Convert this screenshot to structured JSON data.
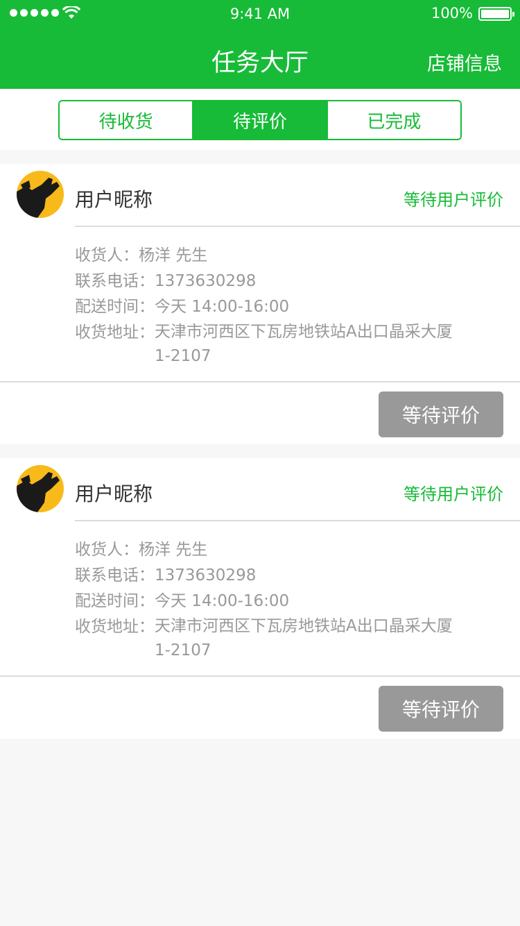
{
  "status_bar": {
    "time": "9:41 AM",
    "battery": "100%"
  },
  "header": {
    "title": "任务大厅",
    "right_action": "店铺信息"
  },
  "tabs": [
    {
      "label": "待收货",
      "active": false
    },
    {
      "label": "待评价",
      "active": true
    },
    {
      "label": "已完成",
      "active": false
    }
  ],
  "orders": [
    {
      "user_name": "用户昵称",
      "status": "等待用户评价",
      "receiver_label": "收货人：",
      "receiver": "杨洋 先生",
      "phone_label": "联系电话：",
      "phone": "1373630298",
      "time_label": "配送时间：",
      "time": "今天 14:00-16:00",
      "address_label": "收货地址：",
      "address": "天津市河西区下瓦房地铁站A出口晶采大厦1-2107",
      "button": "等待评价"
    },
    {
      "user_name": "用户昵称",
      "status": "等待用户评价",
      "receiver_label": "收货人：",
      "receiver": "杨洋 先生",
      "phone_label": "联系电话：",
      "phone": "1373630298",
      "time_label": "配送时间：",
      "time": "今天 14:00-16:00",
      "address_label": "收货地址：",
      "address": "天津市河西区下瓦房地铁站A出口晶采大厦1-2107",
      "button": "等待评价"
    }
  ],
  "colors": {
    "brand": "#17bb37",
    "avatar_bg": "#f8ba1a",
    "button_disabled": "#999999",
    "muted_text": "#999999"
  }
}
